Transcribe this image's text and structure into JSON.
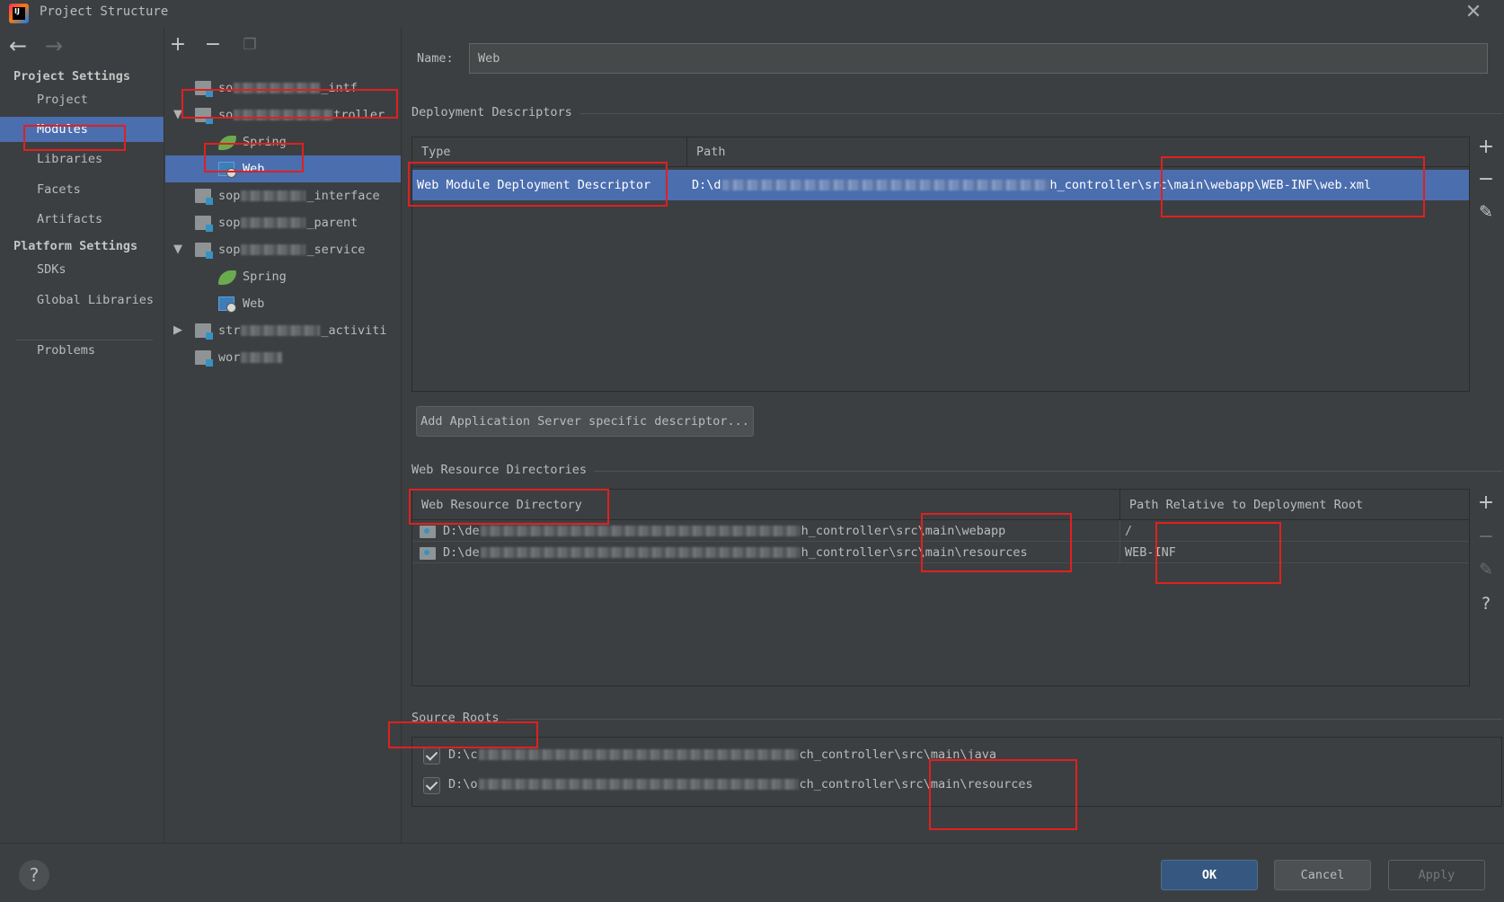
{
  "window": {
    "title": "Project Structure"
  },
  "sidebar": {
    "project_settings": "Project Settings",
    "platform_settings": "Platform Settings",
    "items": [
      {
        "label": "Project"
      },
      {
        "label": "Modules"
      },
      {
        "label": "Libraries"
      },
      {
        "label": "Facets"
      },
      {
        "label": "Artifacts"
      },
      {
        "label": "SDKs"
      },
      {
        "label": "Global Libraries"
      },
      {
        "label": "Problems"
      }
    ]
  },
  "tree": {
    "items": [
      {
        "prefix": "so",
        "suffix": "_intf"
      },
      {
        "prefix": "so",
        "suffix": "troller"
      },
      {
        "label": "Spring"
      },
      {
        "label": "Web"
      },
      {
        "prefix": "sop",
        "suffix": "_interface"
      },
      {
        "prefix": "sop",
        "suffix": "_parent"
      },
      {
        "prefix": "sop",
        "suffix": "_service"
      },
      {
        "label": "Spring"
      },
      {
        "label": "Web"
      },
      {
        "prefix": "str",
        "suffix": "_activiti"
      },
      {
        "prefix": "wor",
        "suffix": ""
      }
    ]
  },
  "facet": {
    "name_label": "Name:",
    "name_value": "Web",
    "deployment": {
      "title": "Deployment Descriptors",
      "col_type": "Type",
      "col_path": "Path",
      "row": {
        "type": "Web Module Deployment Descriptor",
        "path_prefix": "D:\\d",
        "path_suffix": "h_controller\\src\\main\\webapp\\WEB-INF\\web.xml"
      },
      "add_button": "Add Application Server specific descriptor..."
    },
    "web_resources": {
      "title": "Web Resource Directories",
      "col_dir": "Web Resource Directory",
      "col_rel": "Path Relative to Deployment Root",
      "rows": [
        {
          "prefix": "D:\\de",
          "suffix": "h_controller\\src\\main\\webapp",
          "relative": "/"
        },
        {
          "prefix": "D:\\de",
          "suffix": "h_controller\\src\\main\\resources",
          "relative": "WEB-INF"
        }
      ]
    },
    "source_roots": {
      "title": "Source Roots",
      "rows": [
        {
          "prefix": "D:\\c",
          "suffix": "ch_controller\\src\\main\\java",
          "checked": true
        },
        {
          "prefix": "D:\\o",
          "suffix": "ch_controller\\src\\main\\resources",
          "checked": true
        }
      ]
    }
  },
  "footer": {
    "help": "?",
    "ok": "OK",
    "cancel": "Cancel",
    "apply": "Apply"
  },
  "colors": {
    "selection": "#4b6eaf",
    "annotation": "#e02020",
    "background": "#3c3f41"
  }
}
